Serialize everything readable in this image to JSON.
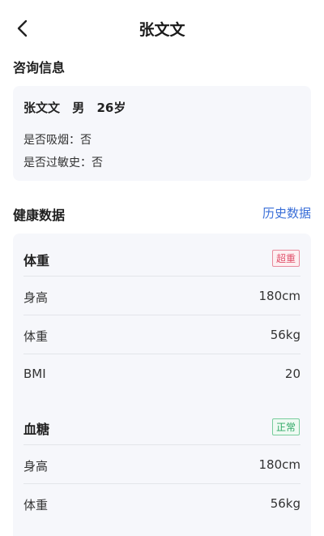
{
  "nav": {
    "title": "张文文"
  },
  "consult": {
    "section_title": "咨询信息",
    "name": "张文文",
    "gender": "男",
    "age": "26岁",
    "smoking": "是否吸烟：否",
    "allergy": "是否过敏史：否"
  },
  "health": {
    "section_title": "健康数据",
    "history_link": "历史数据",
    "groups": [
      {
        "name": "体重",
        "badge": "超重",
        "rows": [
          {
            "label": "身高",
            "value": "180cm"
          },
          {
            "label": "体重",
            "value": "56kg"
          },
          {
            "label": "BMI",
            "value": "20"
          }
        ]
      },
      {
        "name": "血糖",
        "badge": "正常",
        "rows": [
          {
            "label": "身高",
            "value": "180cm"
          },
          {
            "label": "体重",
            "value": "56kg"
          }
        ]
      }
    ]
  },
  "icons": {
    "back": "chevron-left-icon"
  },
  "colors": {
    "link": "#3a6fd8",
    "badge_over": "#e0506a",
    "badge_ok": "#2fa866"
  }
}
